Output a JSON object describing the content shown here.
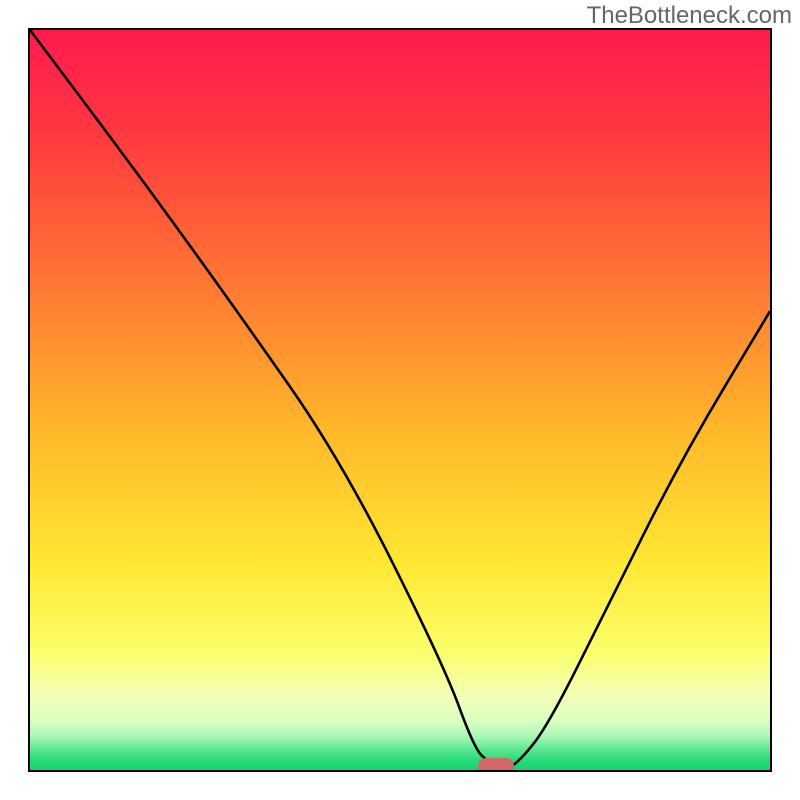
{
  "watermark": "TheBottleneck.com",
  "chart_data": {
    "type": "line",
    "title": "",
    "xlabel": "",
    "ylabel": "",
    "xlim": [
      0,
      100
    ],
    "ylim": [
      0,
      100
    ],
    "series": [
      {
        "name": "curve",
        "x": [
          0,
          15,
          28,
          42,
          56,
          60,
          62,
          64,
          66,
          70,
          78,
          88,
          100
        ],
        "values": [
          100,
          80,
          62,
          42,
          14,
          3,
          1,
          0,
          1,
          6,
          22,
          42,
          62
        ]
      }
    ],
    "marker": {
      "x": 63,
      "y": 0.5
    },
    "gradient_stops": [
      {
        "offset": 0,
        "color": "#ff1a4f"
      },
      {
        "offset": 0.15,
        "color": "#ff3b3f"
      },
      {
        "offset": 0.35,
        "color": "#ff7a33"
      },
      {
        "offset": 0.55,
        "color": "#ffba2a"
      },
      {
        "offset": 0.72,
        "color": "#ffe733"
      },
      {
        "offset": 0.84,
        "color": "#fbff6a"
      },
      {
        "offset": 0.9,
        "color": "#f3ffb8"
      },
      {
        "offset": 0.935,
        "color": "#d8ffc0"
      },
      {
        "offset": 0.955,
        "color": "#a6f7b6"
      },
      {
        "offset": 0.973,
        "color": "#5ae88f"
      },
      {
        "offset": 0.985,
        "color": "#2edc7b"
      },
      {
        "offset": 1.0,
        "color": "#17d46d"
      }
    ]
  }
}
